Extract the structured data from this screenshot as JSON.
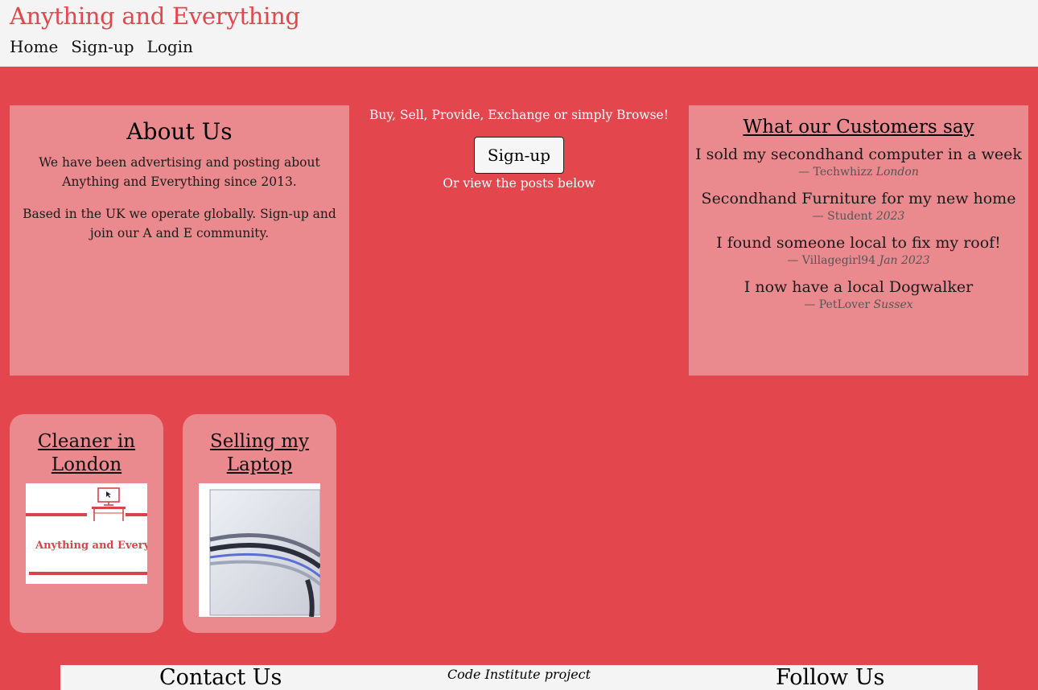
{
  "site": {
    "title": "Anything and Everything"
  },
  "nav": {
    "home": "Home",
    "signup": "Sign-up",
    "login": "Login"
  },
  "about": {
    "heading": "About Us",
    "p1": "We have been advertising and posting about Anything and Everything since 2013.",
    "p2": "Based in the UK we operate globally. Sign-up and join our A and E community."
  },
  "hero": {
    "tagline": "Buy, Sell, Provide, Exchange or simply Browse!",
    "signup_label": "Sign-up",
    "subtext": "Or view the posts below"
  },
  "reviews": {
    "heading": "What our Customers say",
    "items": [
      {
        "quote": "I sold my secondhand computer in a week",
        "dash": "—",
        "author": "Techwhizz",
        "detail": "London"
      },
      {
        "quote": "Secondhand Furniture for my new home",
        "dash": "—",
        "author": "Student",
        "detail": "2023"
      },
      {
        "quote": "I found someone local to fix my roof!",
        "dash": "—",
        "author": "Villagegirl94",
        "detail": "Jan 2023"
      },
      {
        "quote": "I now have a local Dogwalker",
        "dash": "—",
        "author": "PetLover",
        "detail": "Sussex"
      }
    ]
  },
  "posts": [
    {
      "title": "Cleaner in London",
      "image_text": "Anything and Everything"
    },
    {
      "title": "Selling my Laptop"
    }
  ],
  "footer": {
    "contact": "Contact Us",
    "credit": "Code Institute project",
    "follow": "Follow Us"
  },
  "colors": {
    "brand": "#e3474d",
    "panel": "#eb8a8e",
    "header_bg": "#f4f4f4"
  }
}
